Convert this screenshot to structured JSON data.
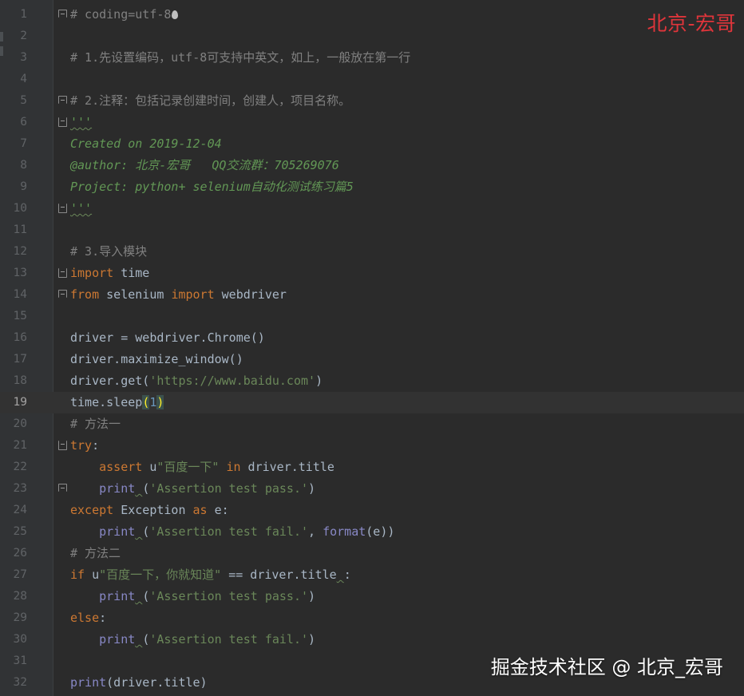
{
  "editor": {
    "current_line": 19,
    "lines": [
      {
        "n": "1",
        "tokens": [
          {
            "t": "# coding=utf-8",
            "c": "cmt"
          }
        ],
        "fold": "start",
        "caret": true
      },
      {
        "n": "2",
        "tokens": []
      },
      {
        "n": "3",
        "tokens": [
          {
            "t": "# 1.先设置编码，utf-8可支持中英文，如上，一般放在第一行",
            "c": "cmt"
          }
        ]
      },
      {
        "n": "4",
        "tokens": []
      },
      {
        "n": "5",
        "tokens": [
          {
            "t": "# 2.注释：包括记录创建时间，创建人，项目名称。",
            "c": "cmt"
          }
        ],
        "fold": "start"
      },
      {
        "n": "6",
        "tokens": [
          {
            "t": "'''",
            "c": "doc",
            "squiggle": true
          }
        ],
        "fold": "end"
      },
      {
        "n": "7",
        "tokens": [
          {
            "t": "Created on 2019-12-04",
            "c": "doc"
          }
        ]
      },
      {
        "n": "8",
        "tokens": [
          {
            "t": "@author: 北京-宏哥   QQ交流群：705269076",
            "c": "doc"
          }
        ]
      },
      {
        "n": "9",
        "tokens": [
          {
            "t": "Project: python+ selenium自动化测试练习篇5",
            "c": "doc"
          }
        ]
      },
      {
        "n": "10",
        "tokens": [
          {
            "t": "'''",
            "c": "doc",
            "squiggle": true
          }
        ],
        "fold": "end"
      },
      {
        "n": "11",
        "tokens": []
      },
      {
        "n": "12",
        "tokens": [
          {
            "t": "# 3.导入模块",
            "c": "cmt"
          }
        ]
      },
      {
        "n": "13",
        "tokens": [
          {
            "t": "import",
            "c": "kw"
          },
          {
            "t": " time",
            "c": "plain"
          }
        ],
        "fold": "end"
      },
      {
        "n": "14",
        "tokens": [
          {
            "t": "from",
            "c": "kw"
          },
          {
            "t": " selenium ",
            "c": "plain"
          },
          {
            "t": "import",
            "c": "kw"
          },
          {
            "t": " webdriver",
            "c": "plain"
          }
        ],
        "fold": "start"
      },
      {
        "n": "15",
        "tokens": []
      },
      {
        "n": "16",
        "tokens": [
          {
            "t": "driver = webdriver.Chrome()",
            "c": "plain"
          }
        ]
      },
      {
        "n": "17",
        "tokens": [
          {
            "t": "driver.maximize_window()",
            "c": "plain"
          }
        ]
      },
      {
        "n": "18",
        "tokens": [
          {
            "t": "driver.get(",
            "c": "plain"
          },
          {
            "t": "'https://www.baidu.com'",
            "c": "str"
          },
          {
            "t": ")",
            "c": "plain"
          }
        ]
      },
      {
        "n": "19",
        "tokens": [
          {
            "t": "time.sleep",
            "c": "plain"
          },
          {
            "t": "(",
            "c": "paren-hl"
          },
          {
            "t": "1",
            "c": "num"
          },
          {
            "t": ")",
            "c": "paren-hl"
          }
        ]
      },
      {
        "n": "20",
        "tokens": [
          {
            "t": "# 方法一",
            "c": "cmt"
          }
        ]
      },
      {
        "n": "21",
        "tokens": [
          {
            "t": "try",
            "c": "kw"
          },
          {
            "t": ":",
            "c": "plain"
          }
        ],
        "fold": "end"
      },
      {
        "n": "22",
        "tokens": [
          {
            "t": "    ",
            "c": "plain"
          },
          {
            "t": "assert",
            "c": "kw"
          },
          {
            "t": " u",
            "c": "plain"
          },
          {
            "t": "\"百度一下\"",
            "c": "str"
          },
          {
            "t": " in",
            "c": "kw"
          },
          {
            "t": " driver.title",
            "c": "plain"
          }
        ]
      },
      {
        "n": "23",
        "tokens": [
          {
            "t": "    ",
            "c": "plain"
          },
          {
            "t": "print",
            "c": "builtin"
          },
          {
            "t": " ",
            "c": "plain",
            "squiggle": true
          },
          {
            "t": "(",
            "c": "plain"
          },
          {
            "t": "'Assertion test pass.'",
            "c": "str"
          },
          {
            "t": ")",
            "c": "plain"
          }
        ],
        "fold": "start"
      },
      {
        "n": "24",
        "tokens": [
          {
            "t": "except",
            "c": "kw"
          },
          {
            "t": " Exception ",
            "c": "plain"
          },
          {
            "t": "as",
            "c": "kw"
          },
          {
            "t": " e:",
            "c": "plain"
          }
        ]
      },
      {
        "n": "25",
        "tokens": [
          {
            "t": "    ",
            "c": "plain"
          },
          {
            "t": "print",
            "c": "builtin"
          },
          {
            "t": " ",
            "c": "plain",
            "squiggle": true
          },
          {
            "t": "(",
            "c": "plain"
          },
          {
            "t": "'Assertion test fail.'",
            "c": "str"
          },
          {
            "t": ", ",
            "c": "plain"
          },
          {
            "t": "format",
            "c": "builtin"
          },
          {
            "t": "(e))",
            "c": "plain"
          }
        ]
      },
      {
        "n": "26",
        "tokens": [
          {
            "t": "# 方法二",
            "c": "cmt"
          }
        ]
      },
      {
        "n": "27",
        "tokens": [
          {
            "t": "if",
            "c": "kw"
          },
          {
            "t": " u",
            "c": "plain"
          },
          {
            "t": "\"百度一下，你就知道\"",
            "c": "str"
          },
          {
            "t": " == driver.title",
            "c": "plain"
          },
          {
            "t": " ",
            "c": "plain",
            "squiggle": true
          },
          {
            "t": ":",
            "c": "plain"
          }
        ]
      },
      {
        "n": "28",
        "tokens": [
          {
            "t": "    ",
            "c": "plain"
          },
          {
            "t": "print",
            "c": "builtin"
          },
          {
            "t": " ",
            "c": "plain",
            "squiggle": true
          },
          {
            "t": "(",
            "c": "plain"
          },
          {
            "t": "'Assertion test pass.'",
            "c": "str"
          },
          {
            "t": ")",
            "c": "plain"
          }
        ]
      },
      {
        "n": "29",
        "tokens": [
          {
            "t": "else",
            "c": "kw"
          },
          {
            "t": ":",
            "c": "plain"
          }
        ]
      },
      {
        "n": "30",
        "tokens": [
          {
            "t": "    ",
            "c": "plain"
          },
          {
            "t": "print",
            "c": "builtin"
          },
          {
            "t": " ",
            "c": "plain",
            "squiggle": true
          },
          {
            "t": "(",
            "c": "plain"
          },
          {
            "t": "'Assertion test fail.'",
            "c": "str"
          },
          {
            "t": ")",
            "c": "plain"
          }
        ]
      },
      {
        "n": "31",
        "tokens": []
      },
      {
        "n": "32",
        "tokens": [
          {
            "t": "print",
            "c": "builtin"
          },
          {
            "t": "(driver.title)",
            "c": "plain"
          }
        ]
      }
    ]
  },
  "watermarks": {
    "top_right": "北京-宏哥",
    "bottom_right": "掘金技术社区 @ 北京_宏哥"
  },
  "colors": {
    "background": "#2b2b2b",
    "gutter": "#313335",
    "keyword": "#cc7832",
    "string": "#6a8759",
    "docstring": "#629755",
    "comment": "#808080",
    "number": "#6897bb",
    "builtin": "#8888c6",
    "watermark_red": "#e0353b"
  }
}
